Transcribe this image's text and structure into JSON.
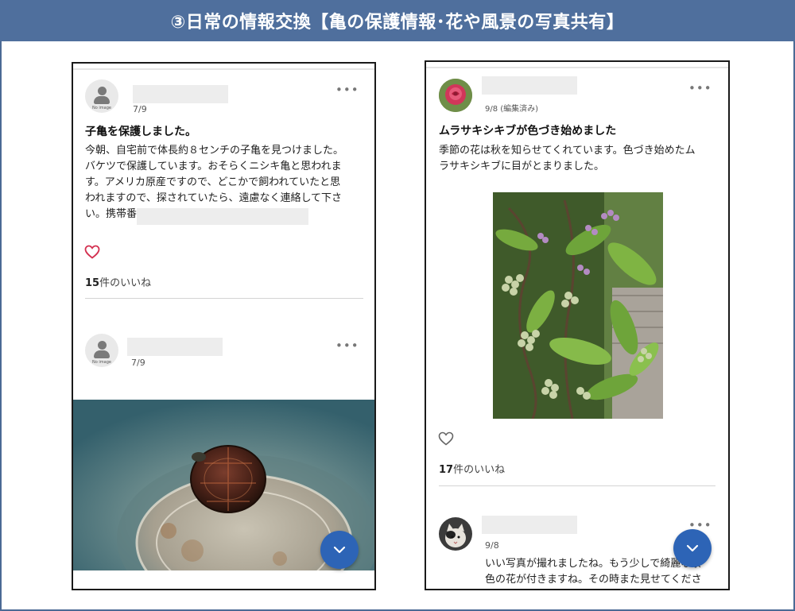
{
  "banner": {
    "title": "③日常の情報交換【亀の保護情報･花や風景の写真共有】"
  },
  "colors": {
    "banner": "#4f6f9d",
    "fab": "#2d64b6",
    "heart_red": "#d32f4f"
  },
  "left_phone": {
    "post1": {
      "avatar_caption": "No image",
      "date": "7/9",
      "title": "子亀を保護しました。",
      "body_lines": [
        "今朝、自宅前で体長約８センチの子亀を見つけました。",
        "バケツで保護しています。おそらくニシキ亀と思われま",
        "す。アメリカ原産ですので、どこかで飼われていたと思",
        "われますので、探されていたら、遠慮なく連絡して下さ",
        "い。携帯番"
      ],
      "like_icon": "heart-outline-icon",
      "likes_count": "15",
      "likes_suffix": "件のいいね"
    },
    "post2": {
      "avatar_caption": "No image",
      "date": "7/9",
      "photo": "turtle-in-bucket-photo"
    },
    "fab_icon": "chevron-down-icon"
  },
  "right_phone": {
    "post1": {
      "avatar": "rose-avatar",
      "date": "9/8 (編集済み)",
      "title": "ムラサキシキブが色づき始めました",
      "body_lines": [
        "季節の花は秋を知らせてくれています。色づき始めたム",
        "ラサキシキブに目がとまりました。"
      ],
      "photo": "beautyberry-photo",
      "like_icon": "heart-outline-icon",
      "likes_count": "17",
      "likes_suffix": "件のいいね"
    },
    "comment": {
      "avatar": "cat-avatar",
      "date": "9/8",
      "body_lines": [
        "いい写真が撮れましたね。もう少しで綺麗な紫",
        "色の花が付きますね。その時また見せてくださ"
      ]
    },
    "fab_icon": "chevron-down-icon"
  }
}
